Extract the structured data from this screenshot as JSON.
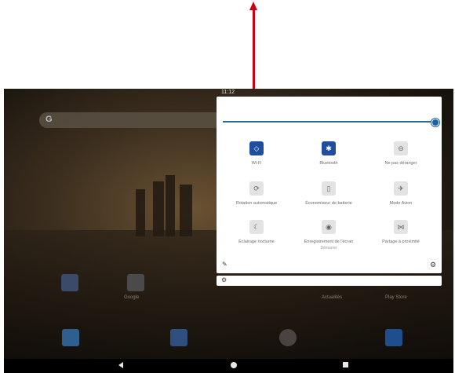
{
  "status": {
    "time": "11:12"
  },
  "colors": {
    "accent": "#1f4e9e",
    "arrow": "#cc0011"
  },
  "quick_settings": {
    "brightness_level": 1.0,
    "tiles": [
      {
        "label": "Wi-Fi",
        "icon": "wifi-icon",
        "active": true,
        "glyph": "◇"
      },
      {
        "label": "Bluetooth",
        "icon": "bluetooth-icon",
        "active": true,
        "glyph": "✱"
      },
      {
        "label": "Ne pas déranger",
        "icon": "do-not-disturb-icon",
        "active": false,
        "glyph": "⊖"
      },
      {
        "label": "Rotation automatique",
        "icon": "auto-rotate-icon",
        "active": false,
        "glyph": "⟳"
      },
      {
        "label": "Économiseur de batterie",
        "icon": "battery-saver-icon",
        "active": false,
        "glyph": "▯"
      },
      {
        "label": "Mode Avion",
        "icon": "airplane-icon",
        "active": false,
        "glyph": "✈"
      },
      {
        "label": "Éclairage nocturne",
        "icon": "night-light-icon",
        "active": false,
        "glyph": "☾"
      },
      {
        "label": "Enregistrement de l'écran",
        "sublabel": "Démarrer",
        "icon": "screen-record-icon",
        "active": false,
        "glyph": "◉"
      },
      {
        "label": "Partage à proximité",
        "icon": "nearby-share-icon",
        "active": false,
        "glyph": "⋈"
      }
    ]
  },
  "home": {
    "search_logo": "G",
    "apps": [
      {
        "name": "Google",
        "label": "Google"
      },
      {
        "name": "Actualités",
        "label": "Actualités"
      },
      {
        "name": "Play Store",
        "label": "Play Store"
      }
    ]
  }
}
